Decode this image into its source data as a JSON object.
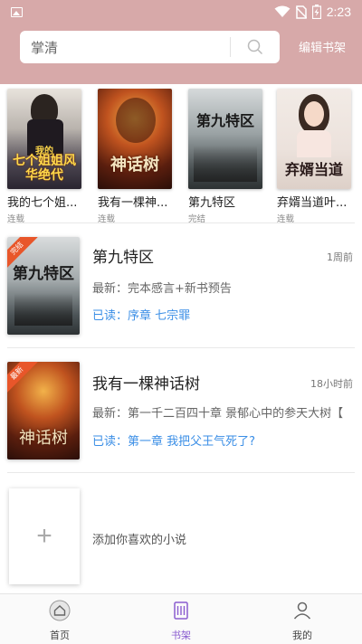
{
  "status_bar": {
    "time": "2:23"
  },
  "header": {
    "search_query": "掌清",
    "edit_label": "编辑书架"
  },
  "featured": [
    {
      "title": "我的七个姐...",
      "status": "连载",
      "cover_text": "七个姐姐风华绝代",
      "cover_top": "我的"
    },
    {
      "title": "我有一棵神...",
      "status": "连载",
      "cover_text": "神话树"
    },
    {
      "title": "第九特区",
      "status": "完结",
      "cover_text": "第九特区"
    },
    {
      "title": "弃婿当道叶...",
      "status": "连载",
      "cover_text": "弃婿当道"
    }
  ],
  "books": [
    {
      "title": "第九特区",
      "time": "1周前",
      "latest": "最新：完本感言+新书预告",
      "read": "已读：序章 七宗罪",
      "cover_text": "第九特区",
      "badge": "完结"
    },
    {
      "title": "我有一棵神话树",
      "time": "18小时前",
      "latest": "最新：第一千二百四十章 景郁心中的参天大树【",
      "read": "已读：第一章 我把父王气死了?",
      "cover_text": "神话树",
      "badge": "最新"
    }
  ],
  "add_book": {
    "label": "添加你喜欢的小说"
  },
  "nav": [
    {
      "label": "首页"
    },
    {
      "label": "书架"
    },
    {
      "label": "我的"
    }
  ],
  "colors": {
    "header": "#d7a9a9",
    "link": "#3a8ee6",
    "active_nav": "#8a5cd0"
  }
}
